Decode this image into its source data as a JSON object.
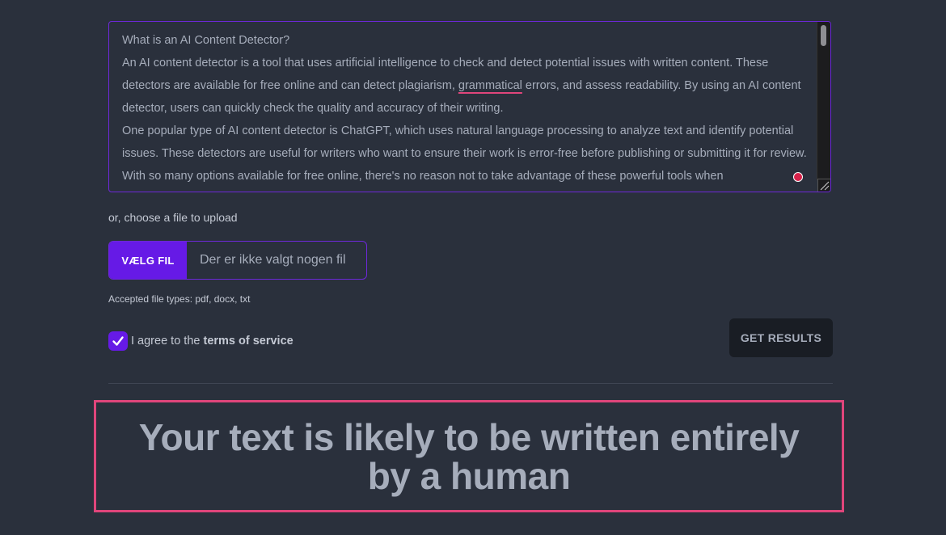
{
  "textarea": {
    "paragraphs": [
      "What is an AI Content Detector?",
      "An AI content detector is a tool that uses artificial intelligence to check and detect potential issues with written content. These detectors are available for free online and can detect plagiarism, ",
      "One popular type of AI content detector is ChatGPT, which uses natural language processing to analyze text and identify potential issues. These detectors are useful for writers who want to ensure their work is error-free before publishing or submitting it for review. With so many options available for free online, there's no reason not to take advantage of these powerful tools when"
    ],
    "underlined_word": "grammatical",
    "after_underline": " errors, and assess readability. By using an AI content detector, users can quickly check the quality and accuracy of their writing."
  },
  "upload": {
    "or_label": "or, choose a file to upload",
    "button_label": "VÆLG FIL",
    "status": "Der er ikke valgt nogen fil",
    "accepted_types": "Accepted file types: pdf, docx, txt"
  },
  "agree": {
    "prefix": "I agree to the ",
    "link": "terms of service",
    "checked": true
  },
  "actions": {
    "get_results": "GET RESULTS"
  },
  "result": {
    "line1": "Your text is likely to be written entirely",
    "line2": "by a human"
  },
  "colors": {
    "background": "#2a303c",
    "primary": "#661ae6",
    "accent": "#e0457b",
    "text": "#a6adbb"
  }
}
